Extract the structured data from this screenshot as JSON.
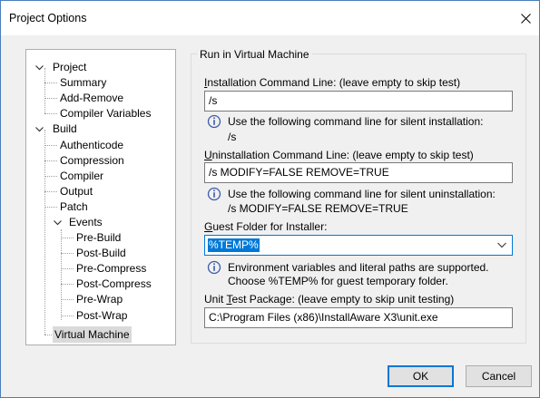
{
  "window": {
    "title": "Project Options"
  },
  "tree": {
    "project": "Project",
    "summary": "Summary",
    "add_remove": "Add-Remove",
    "compiler_variables": "Compiler Variables",
    "build": "Build",
    "authenticode": "Authenticode",
    "compression": "Compression",
    "compiler": "Compiler",
    "output": "Output",
    "patch": "Patch",
    "events": "Events",
    "pre_build": "Pre-Build",
    "post_build": "Post-Build",
    "pre_compress": "Pre-Compress",
    "post_compress": "Post-Compress",
    "pre_wrap": "Pre-Wrap",
    "post_wrap": "Post-Wrap",
    "virtual_machine": "Virtual Machine"
  },
  "panel": {
    "group_title": "Run in Virtual Machine",
    "install": {
      "label_key": "I",
      "label_rest": "nstallation Command Line: (leave empty to skip test)",
      "value": "/s",
      "note_line1": "Use the following command line for silent installation:",
      "note_line2": "/s"
    },
    "uninstall": {
      "label_key": "U",
      "label_rest": "ninstallation Command Line: (leave empty to skip test)",
      "value": "/s MODIFY=FALSE REMOVE=TRUE",
      "note_line1": "Use the following command line for silent uninstallation:",
      "note_line2": "/s MODIFY=FALSE REMOVE=TRUE"
    },
    "guest": {
      "label_key": "G",
      "label_rest": "uest Folder for Installer:",
      "value": "%TEMP%",
      "note_line1": "Environment variables and literal paths are supported.",
      "note_line2": "Choose %TEMP% for guest temporary folder."
    },
    "unit_test": {
      "label_pre": "Unit ",
      "label_key": "T",
      "label_rest": "est Package: (leave empty to skip unit testing)",
      "value": "C:\\Program Files (x86)\\InstallAware X3\\unit.exe"
    }
  },
  "buttons": {
    "ok": "OK",
    "cancel": "Cancel"
  }
}
